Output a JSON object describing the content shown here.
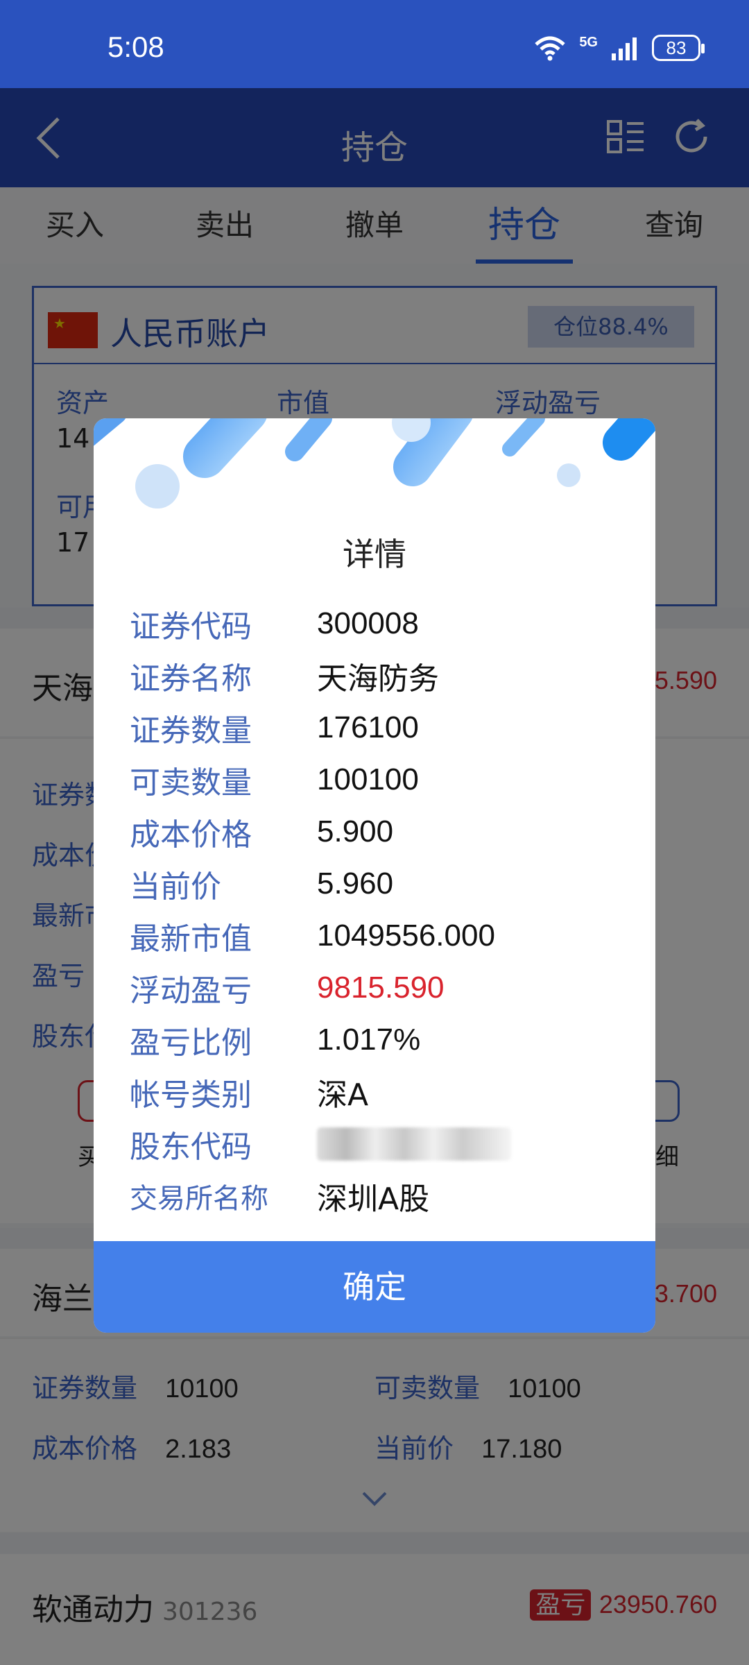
{
  "status_bar": {
    "time": "5:08",
    "network": "5G",
    "battery": "83"
  },
  "navbar": {
    "title": "持仓",
    "back_icon": "chevron-left-icon",
    "menu_icon": "list-icon",
    "refresh_icon": "refresh-icon"
  },
  "tabs": [
    {
      "label": "买入",
      "active": false
    },
    {
      "label": "卖出",
      "active": false
    },
    {
      "label": "撤单",
      "active": false
    },
    {
      "label": "持仓",
      "active": true
    },
    {
      "label": "查询",
      "active": false
    }
  ],
  "account": {
    "name": "人民币账户",
    "position_ratio": "仓位88.4%",
    "labels": {
      "assets": "资产",
      "market_value": "市值",
      "floating_pl": "浮动盈亏"
    },
    "asset_value_partial": "14",
    "available_label_partial": "可用",
    "available_value_partial": "17"
  },
  "holding1": {
    "name_partial": "天海",
    "pl_partial": "5.590",
    "labels": [
      "证券数",
      "成本价",
      "最新市",
      "盈亏",
      "股东代"
    ],
    "action_buy_partial": "买",
    "action_detail_partial": "细"
  },
  "holding2": {
    "name_partial": "海兰",
    "pl_partial": "3.700",
    "qty_label": "证券数量",
    "qty_value": "10100",
    "sellable_label": "可卖数量",
    "sellable_value": "10100",
    "cost_label": "成本价格",
    "cost_value": "2.183",
    "price_label": "当前价",
    "price_value": "17.180"
  },
  "holding3": {
    "name": "软通动力",
    "code": "301236",
    "pl_badge": "盈亏",
    "pl_value": "23950.760"
  },
  "dialog": {
    "title": "详情",
    "rows": [
      {
        "key": "证券代码",
        "value": "300008"
      },
      {
        "key": "证券名称",
        "value": "天海防务"
      },
      {
        "key": "证券数量",
        "value": "176100"
      },
      {
        "key": "可卖数量",
        "value": "100100"
      },
      {
        "key": "成本价格",
        "value": "5.900"
      },
      {
        "key": "当前价",
        "value": "5.960"
      },
      {
        "key": "最新市值",
        "value": "1049556.000"
      },
      {
        "key": "浮动盈亏",
        "value": "9815.590"
      },
      {
        "key": "盈亏比例",
        "value": "1.017%"
      },
      {
        "key": "帐号类别",
        "value": "深A"
      },
      {
        "key": "股东代码",
        "value": ""
      },
      {
        "key": "交易所名称",
        "value": "深圳A股"
      }
    ],
    "confirm_label": "确定"
  },
  "colors": {
    "primary": "#2648b8",
    "accent": "#4480ea",
    "loss_profit_red": "#d9232d",
    "label_blue": "#4668b8"
  }
}
